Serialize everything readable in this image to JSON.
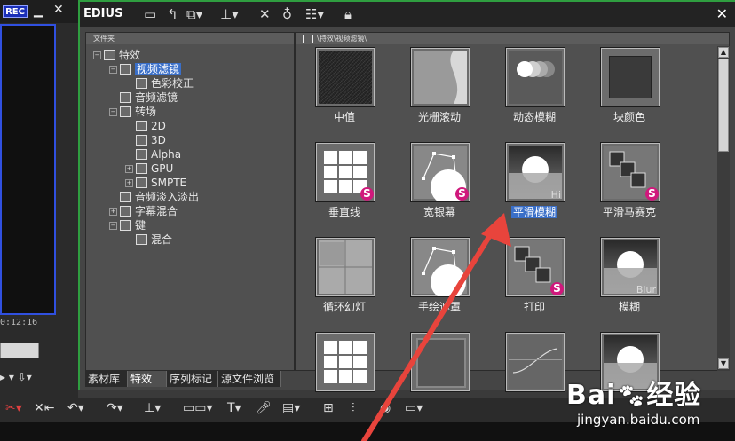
{
  "left_panel": {
    "rec_label": "REC",
    "timecode": "0:12:16"
  },
  "bin_window": {
    "app_name": "EDIUS",
    "folder_pane_header": "文件夹",
    "tree": [
      {
        "label": "特效",
        "indent": 0,
        "expander": "−"
      },
      {
        "label": "视频滤镜",
        "indent": 1,
        "expander": "−",
        "selected": true
      },
      {
        "label": "色彩校正",
        "indent": 2,
        "expander": ""
      },
      {
        "label": "音频滤镜",
        "indent": 1,
        "expander": ""
      },
      {
        "label": "转场",
        "indent": 1,
        "expander": "−"
      },
      {
        "label": "2D",
        "indent": 2,
        "expander": ""
      },
      {
        "label": "3D",
        "indent": 2,
        "expander": ""
      },
      {
        "label": "Alpha",
        "indent": 2,
        "expander": ""
      },
      {
        "label": "GPU",
        "indent": 2,
        "expander": "+"
      },
      {
        "label": "SMPTE",
        "indent": 2,
        "expander": "+"
      },
      {
        "label": "音频淡入淡出",
        "indent": 1,
        "expander": ""
      },
      {
        "label": "字幕混合",
        "indent": 1,
        "expander": "+"
      },
      {
        "label": "键",
        "indent": 1,
        "expander": "−"
      },
      {
        "label": "混合",
        "indent": 2,
        "expander": ""
      }
    ],
    "effects_path": "\\特效\\视频滤镜\\",
    "effects": [
      {
        "label": "中值",
        "kind": "noise"
      },
      {
        "label": "光栅滚动",
        "kind": "wave"
      },
      {
        "label": "动态模糊",
        "kind": "motion"
      },
      {
        "label": "块颜色",
        "kind": "block"
      },
      {
        "label": "垂直线",
        "kind": "grid",
        "badge": "S"
      },
      {
        "label": "宽银幕",
        "kind": "curve",
        "badge": "S"
      },
      {
        "label": "平滑模糊",
        "kind": "sun",
        "corner": "Hi",
        "selected": true
      },
      {
        "label": "平滑马赛克",
        "kind": "squares",
        "badge": "S"
      },
      {
        "label": "循环幻灯",
        "kind": "quad"
      },
      {
        "label": "手绘遮罩",
        "kind": "curve"
      },
      {
        "label": "打印",
        "kind": "squares",
        "badge": "S"
      },
      {
        "label": "模糊",
        "kind": "sun",
        "corner": "Blur"
      },
      {
        "label": "",
        "kind": "grid"
      },
      {
        "label": "",
        "kind": "frame"
      },
      {
        "label": "",
        "kind": "line"
      },
      {
        "label": "",
        "kind": "sun"
      }
    ],
    "tabs": [
      "素材库",
      "特效",
      "序列标记",
      "源文件浏览"
    ],
    "active_tab": "特效"
  },
  "watermark": {
    "brand": "Bai",
    "brand_cn": "经验",
    "url": "jingyan.baidu.com"
  },
  "colors": {
    "selection": "#3a6fc8",
    "badge": "#d0187c",
    "arrow": "#e8443c",
    "window_border": "#2f9e40"
  }
}
